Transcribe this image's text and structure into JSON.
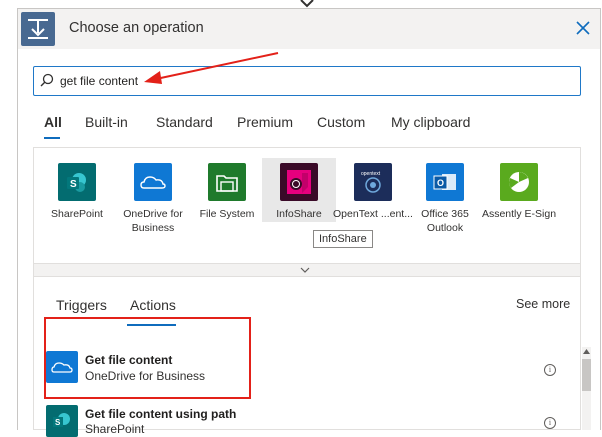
{
  "header": {
    "title": "Choose an operation",
    "close_icon": "close-icon",
    "icon": "operation-icon",
    "accent_color": "#486991"
  },
  "search": {
    "value": "get file content",
    "placeholder": ""
  },
  "tabs": [
    {
      "label": "All",
      "active": true
    },
    {
      "label": "Built-in"
    },
    {
      "label": "Standard"
    },
    {
      "label": "Premium"
    },
    {
      "label": "Custom"
    },
    {
      "label": "My clipboard"
    }
  ],
  "connectors": [
    {
      "label": "SharePoint",
      "color": "#036c70"
    },
    {
      "label": "OneDrive for Business",
      "color": "#0f78d4"
    },
    {
      "label": "File System",
      "color": "#1f7a2c"
    },
    {
      "label": "InfoShare",
      "color": "#e6007e"
    },
    {
      "label": "OpenText ...ent...",
      "color": "#1c2d5a"
    },
    {
      "label": "Office 365 Outlook",
      "color": "#0f78d4"
    },
    {
      "label": "Assently E-Sign",
      "color": "#5aaa1e"
    }
  ],
  "tooltip": "InfoShare",
  "subtabs": [
    {
      "label": "Triggers"
    },
    {
      "label": "Actions",
      "active": true
    }
  ],
  "see_more": "See more",
  "actions": [
    {
      "title": "Get file content",
      "subtitle": "OneDrive for Business",
      "icon_color": "#0f78d4"
    },
    {
      "title": "Get file content using path",
      "subtitle": "SharePoint",
      "icon_color": "#036c70"
    }
  ],
  "annotation_color": "#e32119"
}
